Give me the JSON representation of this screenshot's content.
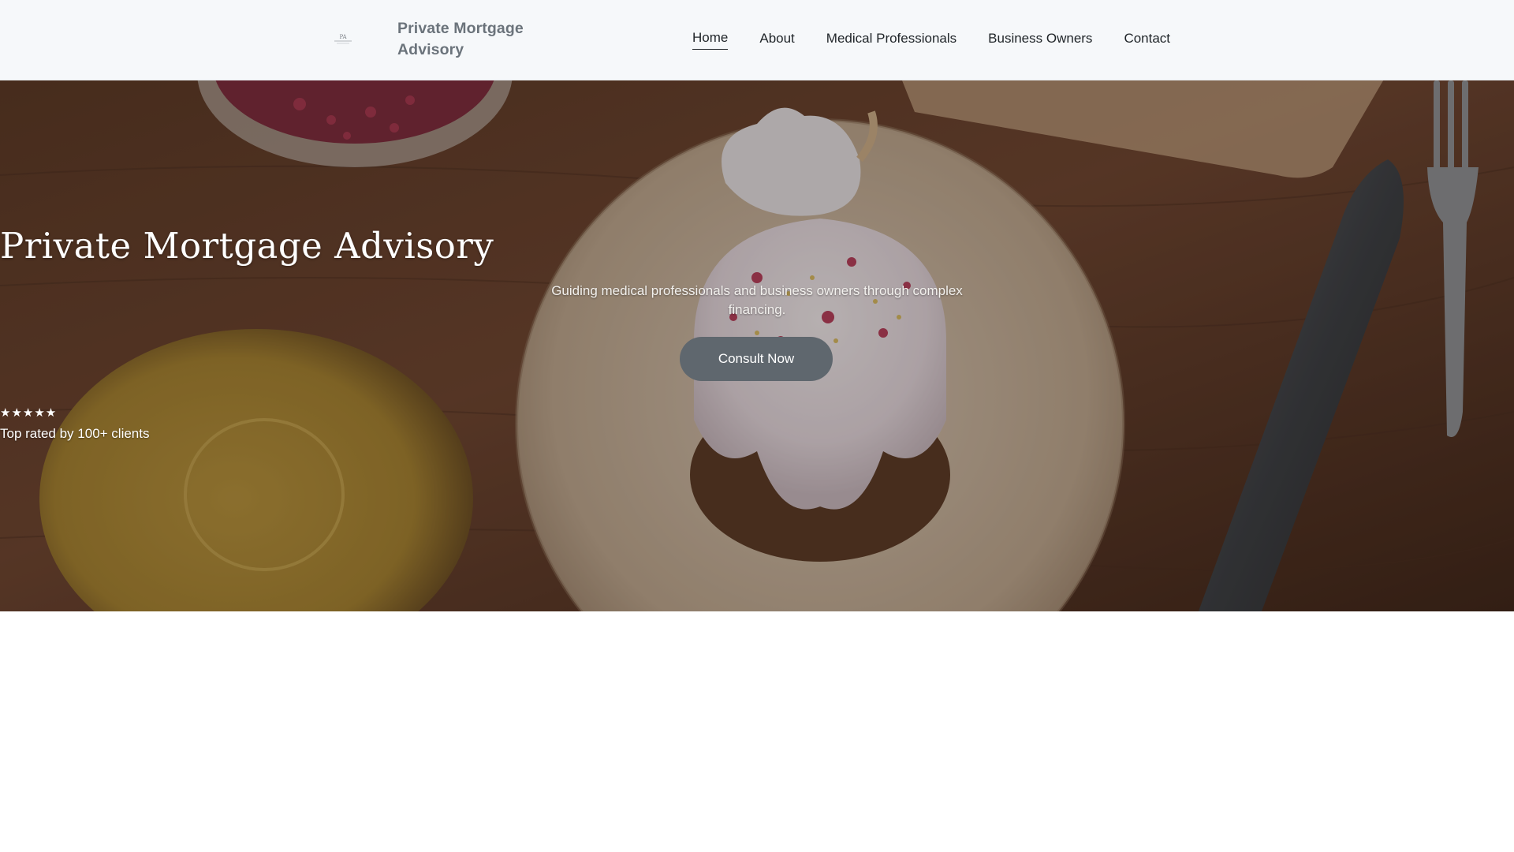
{
  "header": {
    "brand": "Private Mortgage Advisory",
    "nav": [
      {
        "label": "Home",
        "active": true
      },
      {
        "label": "About",
        "active": false
      },
      {
        "label": "Medical Professionals",
        "active": false
      },
      {
        "label": "Business Owners",
        "active": false
      },
      {
        "label": "Contact",
        "active": false
      }
    ]
  },
  "hero": {
    "title": "Private Mortgage Advisory",
    "subtitle": "Guiding medical professionals and business owners through complex financing.",
    "cta_label": "Consult Now",
    "stars": "★★★★★",
    "rating_text": "Top rated by 100+ clients"
  },
  "colors": {
    "header_bg": "#f6f8fa",
    "brand_text": "#6b737b",
    "cta_bg": "#5f676e",
    "hero_text": "#ffffff"
  }
}
